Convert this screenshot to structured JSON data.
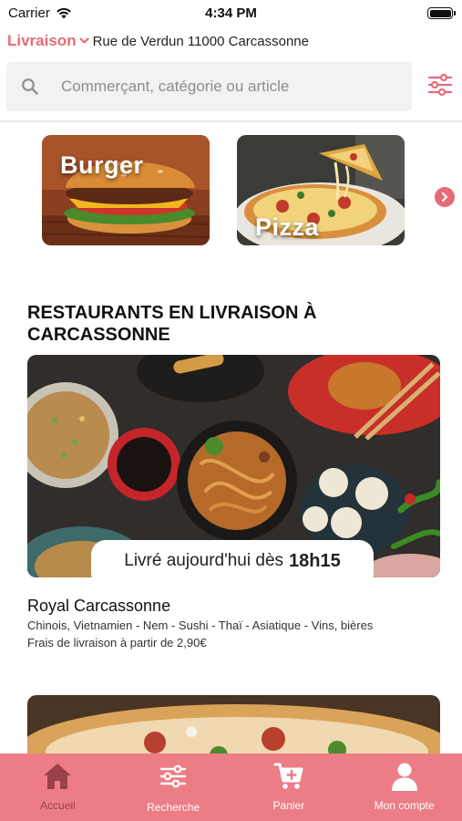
{
  "status_bar": {
    "carrier": "Carrier",
    "time": "4:34 PM"
  },
  "header": {
    "mode": "Livraison",
    "address": "Rue de Verdun 11000 Carcassonne"
  },
  "search": {
    "placeholder": "Commerçant, catégorie ou article"
  },
  "categories": [
    {
      "label": "Burger"
    },
    {
      "label": "Pizza"
    }
  ],
  "section": {
    "title": "RESTAURANTS EN LIVRAISON À CARCASSONNE"
  },
  "restaurants": [
    {
      "delivery_prefix": "Livré aujourd'hui dès",
      "delivery_time": "18h15",
      "name": "Royal Carcassonne",
      "tags": "Chinois, Vietnamien - Nem - Sushi - Thaï - Asiatique - Vins, bières",
      "fee": "Frais de livraison à partir de 2,90€"
    }
  ],
  "tab_bar": {
    "items": [
      {
        "label": "Accueil",
        "icon": "home-icon",
        "active": true
      },
      {
        "label": "Recherche",
        "icon": "sliders-icon",
        "active": false
      },
      {
        "label": "Panier",
        "icon": "cart-icon",
        "active": false
      },
      {
        "label": "Mon compte",
        "icon": "user-icon",
        "active": false
      }
    ]
  },
  "colors": {
    "accent": "#e86a78",
    "tab_bar": "#ec7d86",
    "active_tab_label": "#9a4249"
  }
}
